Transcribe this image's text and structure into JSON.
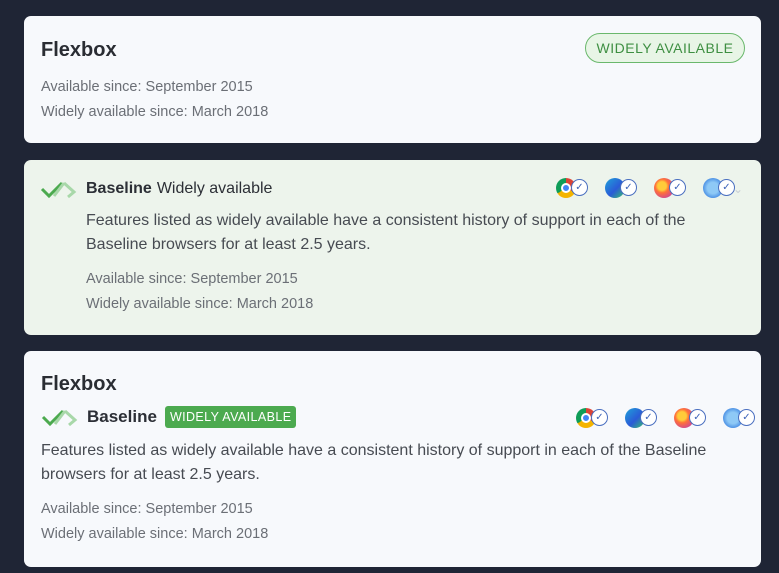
{
  "card1": {
    "title": "Flexbox",
    "badge": "WIDELY AVAILABLE",
    "available_since": "Available since: September 2015",
    "widely_since": "Widely available since: March 2018"
  },
  "card2": {
    "baseline": "Baseline",
    "status": "Widely available",
    "description_line1": "Features listed as widely available have a consistent history of support in each of the",
    "description_line2": "Baseline browsers for at least 2.5 years.",
    "available_since": "Available since: September 2015",
    "widely_since": "Widely available since: March 2018"
  },
  "card3": {
    "title": "Flexbox",
    "baseline": "Baseline",
    "badge": "WIDELY AVAILABLE",
    "description_line1": "Features listed as widely available have a consistent history of support in each of the Baseline",
    "description_line2": "browsers for at least 2.5 years.",
    "available_since": "Available since: September 2015",
    "widely_since": "Widely available since: March 2018"
  },
  "browsers": [
    "chrome-icon",
    "edge-icon",
    "firefox-icon",
    "safari-icon"
  ],
  "colors": {
    "accent_green": "#4caa4f",
    "check_blue": "#4a6fc0",
    "background": "#1f2535"
  }
}
